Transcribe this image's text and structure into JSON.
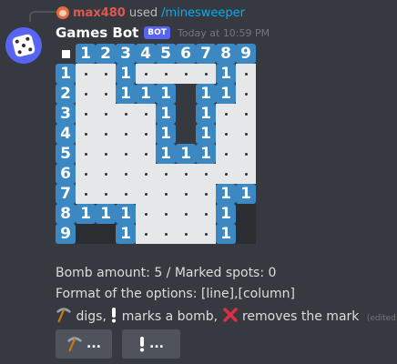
{
  "reply": {
    "username": "max480",
    "used_text": "used",
    "command": "/minesweeper"
  },
  "message": {
    "author": "Games Bot",
    "tag": "BOT",
    "timestamp": "Today at 10:59 PM"
  },
  "board": {
    "header": [
      "1",
      "2",
      "3",
      "4",
      "5",
      "6",
      "7",
      "8",
      "9"
    ],
    "rows": [
      {
        "label": "1",
        "cells": [
          "w",
          "w",
          "1",
          "w",
          "w",
          "w",
          "w",
          "1",
          "w"
        ]
      },
      {
        "label": "2",
        "cells": [
          "w",
          "w",
          "1",
          "1",
          "1",
          "b",
          "1",
          "1",
          "w"
        ]
      },
      {
        "label": "3",
        "cells": [
          "w",
          "w",
          "w",
          "w",
          "1",
          "b",
          "1",
          "w",
          "w"
        ]
      },
      {
        "label": "4",
        "cells": [
          "w",
          "w",
          "w",
          "w",
          "1",
          "b",
          "1",
          "w",
          "w"
        ]
      },
      {
        "label": "5",
        "cells": [
          "w",
          "w",
          "w",
          "w",
          "1",
          "1",
          "1",
          "w",
          "w"
        ]
      },
      {
        "label": "6",
        "cells": [
          "w",
          "w",
          "w",
          "w",
          "w",
          "w",
          "w",
          "w",
          "w"
        ]
      },
      {
        "label": "7",
        "cells": [
          "w",
          "w",
          "w",
          "w",
          "w",
          "w",
          "w",
          "1",
          "1"
        ]
      },
      {
        "label": "8",
        "cells": [
          "1",
          "1",
          "1",
          "w",
          "w",
          "w",
          "w",
          "1",
          "d"
        ]
      },
      {
        "label": "9",
        "cells": [
          "d",
          "d",
          "1",
          "w",
          "w",
          "w",
          "w",
          "1",
          "d"
        ]
      }
    ]
  },
  "info": {
    "bomb_line": "Bomb amount: 5 / Marked spots: 0",
    "format_line": "Format of the options: [line],[column]",
    "legend_digs": "digs,",
    "legend_marks": "marks a bomb,",
    "legend_removes": "removes the mark",
    "edited": "(edited)"
  },
  "buttons": {
    "dig_label": "...",
    "mark_label": "..."
  },
  "colors": {
    "accent": "#5865f2",
    "number_tile": "#3b88c3",
    "background": "#36393f"
  }
}
